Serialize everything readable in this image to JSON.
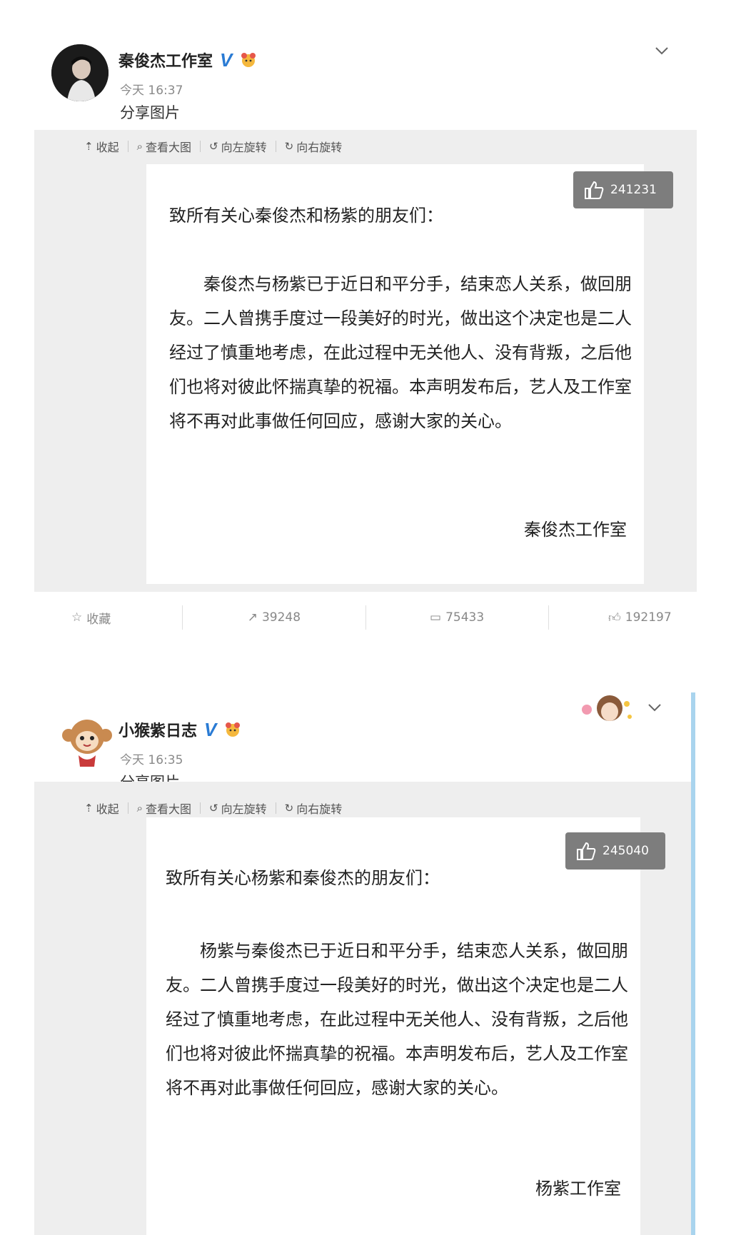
{
  "posts": [
    {
      "account_name": "秦俊杰工作室",
      "time": "今天 16:37",
      "share_text": "分享图片",
      "toolbar": [
        "收起",
        "查看大图",
        "向左旋转",
        "向右旋转"
      ],
      "likes_badge": "241231",
      "greeting": "致所有关心秦俊杰和杨紫的朋友们：",
      "body": "秦俊杰与杨紫已于近日和平分手，结束恋人关系，做回朋友。二人曾携手度过一段美好的时光，做出这个决定也是二人经过了慎重地考虑，在此过程中无关他人、没有背叛，之后他们也将对彼此怀揣真挚的祝福。本声明发布后，艺人及工作室将不再对此事做任何回应，感谢大家的关心。",
      "signature": "秦俊杰工作室",
      "actions": {
        "favorite": "收藏",
        "reposts": "39248",
        "comments": "75433",
        "likes": "192197"
      }
    },
    {
      "account_name": "小猴紫日志",
      "time": "今天 16:35",
      "share_text": "分享图片",
      "toolbar": [
        "收起",
        "查看大图",
        "向左旋转",
        "向右旋转"
      ],
      "likes_badge": "245040",
      "greeting": "致所有关心杨紫和秦俊杰的朋友们：",
      "body": "杨紫与秦俊杰已于近日和平分手，结束恋人关系，做回朋友。二人曾携手度过一段美好的时光，做出这个决定也是二人经过了慎重地考虑，在此过程中无关他人、没有背叛，之后他们也将对彼此怀揣真挚的祝福。本声明发布后，艺人及工作室将不再对此事做任何回应，感谢大家的关心。",
      "signature": "杨紫工作室"
    }
  ],
  "colors": {
    "verified": "#2a7bd4",
    "panel": "#eeeeee",
    "badge": "#7d7d7d",
    "side_bar": "#a9d4ee"
  },
  "icons": [
    "chevron-down-icon",
    "verified-v-icon",
    "vip-icon",
    "collapse-icon",
    "search-icon",
    "rotate-left-icon",
    "rotate-right-icon",
    "thumbs-up-icon",
    "star-icon",
    "repost-icon",
    "comment-icon"
  ]
}
